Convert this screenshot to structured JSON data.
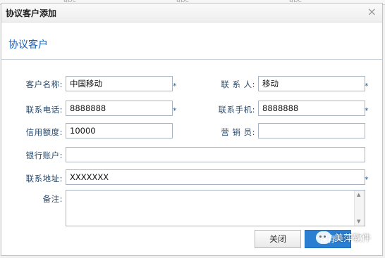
{
  "dialog": {
    "title": "协议客户添加",
    "close_glyph": "×",
    "section_title": "协议客户"
  },
  "fields": {
    "customer_name": {
      "label": "客户名称:",
      "value": "中国移动",
      "required": "*"
    },
    "contact_person": {
      "label": "联 系 人:",
      "value": "移动",
      "required": "*"
    },
    "contact_phone": {
      "label": "联系电话:",
      "value": "8888888",
      "required": "*"
    },
    "contact_mobile": {
      "label": "联系手机:",
      "value": "8888888",
      "required": "*"
    },
    "credit_limit": {
      "label": "信用额度:",
      "value": "10000"
    },
    "salesperson": {
      "label": "营 销 员:",
      "value": ""
    },
    "bank_account": {
      "label": "银行账户:",
      "value": ""
    },
    "address": {
      "label": "联系地址:",
      "value": "XXXXXXX",
      "required": "*"
    },
    "remark": {
      "label": "备注:",
      "value": ""
    }
  },
  "buttons": {
    "close_label": "关闭",
    "save_label": "保存"
  },
  "watermark": {
    "text": "美萍软件"
  },
  "colors": {
    "accent": "#1c5fb4",
    "save_button": "#2a7fd2",
    "label": "#2b4a6b"
  }
}
